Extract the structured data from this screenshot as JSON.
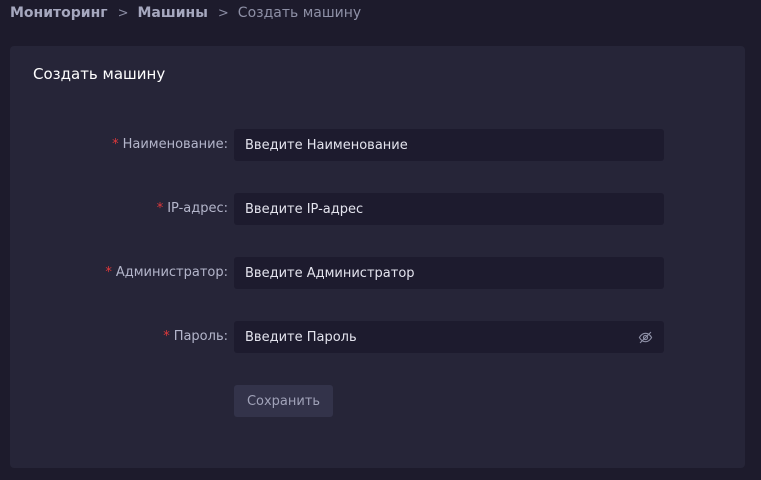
{
  "breadcrumb": {
    "items": [
      "Мониторинг",
      "Машины"
    ],
    "current": "Создать машину",
    "separator": ">"
  },
  "card": {
    "title": "Создать машину"
  },
  "form": {
    "fields": [
      {
        "required_mark": "*",
        "label": "Наименование:",
        "placeholder": "Введите Наименование"
      },
      {
        "required_mark": "*",
        "label": "IP-адрес:",
        "placeholder": "Введите IP-адрес"
      },
      {
        "required_mark": "*",
        "label": "Администратор:",
        "placeholder": "Введите Администратор"
      },
      {
        "required_mark": "*",
        "label": "Пароль:",
        "placeholder": "Введите Пароль",
        "icon": "eye-off-icon"
      }
    ],
    "save_label": "Сохранить"
  },
  "colors": {
    "background": "#1d1b2c",
    "card": "#262538",
    "input": "#1d1b2e",
    "required": "#e2393b",
    "button": "#33334a"
  }
}
